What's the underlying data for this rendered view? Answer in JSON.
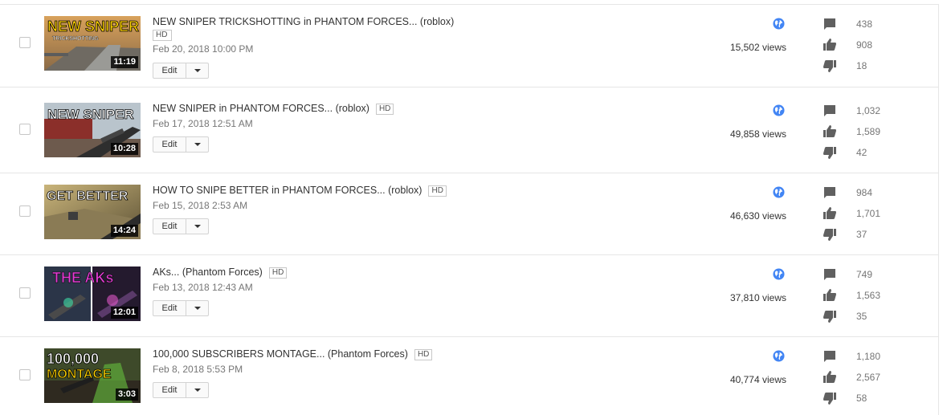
{
  "hd_label": "HD",
  "edit_label": "Edit",
  "icons": {
    "visibility": "globe-icon",
    "comments": "comment-icon",
    "likes": "thumbs-up-icon",
    "dislikes": "thumbs-down-icon"
  },
  "colors": {
    "globe": "#4285f4",
    "stat_icon": "#606060",
    "divider": "#e6e6e6"
  },
  "videos": [
    {
      "thumb_text_1": "NEW SNIPER",
      "thumb_text_2": "TRICKSHOTTING",
      "duration": "11:19",
      "title": "NEW SNIPER TRICKSHOTTING in PHANTOM FORCES... (roblox)",
      "date": "Feb 20, 2018 10:00 PM",
      "views": "15,502 views",
      "comments": "438",
      "likes": "908",
      "dislikes": "18"
    },
    {
      "thumb_text_1": "NEW SNIPER",
      "duration": "10:28",
      "title": "NEW SNIPER in PHANTOM FORCES... (roblox)",
      "date": "Feb 17, 2018 12:51 AM",
      "views": "49,858 views",
      "comments": "1,032",
      "likes": "1,589",
      "dislikes": "42"
    },
    {
      "thumb_text_1": "GET BETTER",
      "duration": "14:24",
      "title": "HOW TO SNIPE BETTER in PHANTOM FORCES... (roblox)",
      "date": "Feb 15, 2018 2:53 AM",
      "views": "46,630 views",
      "comments": "984",
      "likes": "1,701",
      "dislikes": "37"
    },
    {
      "thumb_text_1": "THE AKs",
      "duration": "12:01",
      "title": "AKs... (Phantom Forces)",
      "date": "Feb 13, 2018 12:43 AM",
      "views": "37,810 views",
      "comments": "749",
      "likes": "1,563",
      "dislikes": "35"
    },
    {
      "thumb_text_1": "100,000",
      "thumb_text_2": "MONTAGE",
      "duration": "3:03",
      "title": "100,000 SUBSCRIBERS MONTAGE... (Phantom Forces)",
      "date": "Feb 8, 2018 5:53 PM",
      "views": "40,774 views",
      "comments": "1,180",
      "likes": "2,567",
      "dislikes": "58"
    }
  ]
}
